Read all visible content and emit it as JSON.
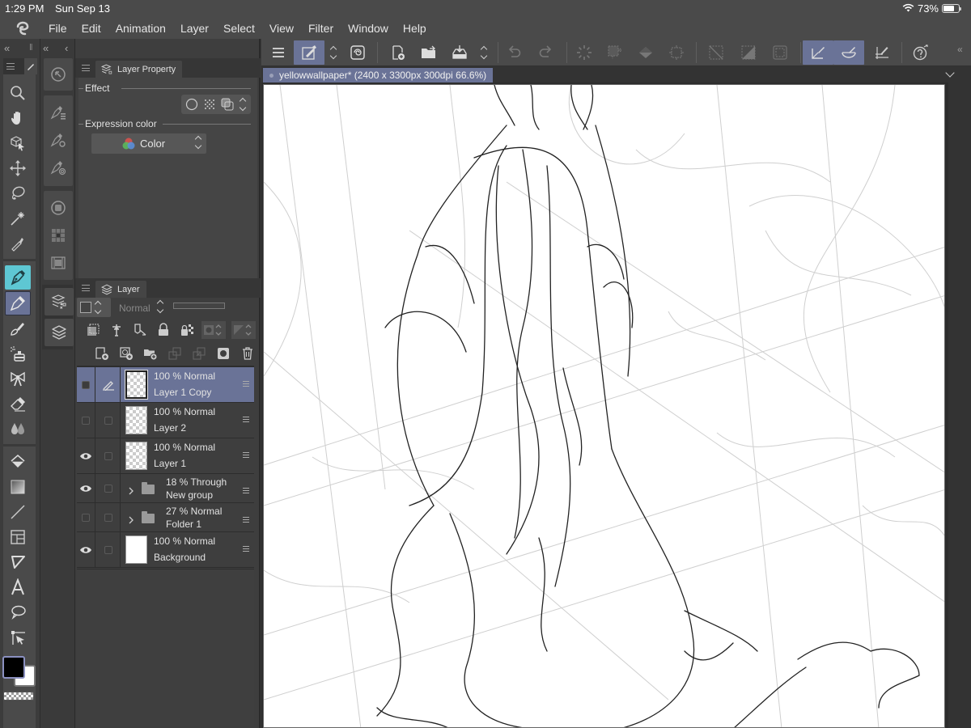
{
  "status_bar": {
    "time": "1:29 PM",
    "date": "Sun Sep 13",
    "battery": "73%",
    "battery_level": 0.73
  },
  "menubar": {
    "items": [
      "File",
      "Edit",
      "Animation",
      "Layer",
      "Select",
      "View",
      "Filter",
      "Window",
      "Help"
    ]
  },
  "toolbar": {
    "buttons": [
      {
        "name": "menu-icon"
      },
      {
        "name": "quick-access-icon",
        "active": true
      },
      {
        "name": "stepper-icon"
      },
      {
        "name": "clip-studio-icon"
      },
      {
        "name": "new-canvas-icon"
      },
      {
        "name": "open-folder-icon"
      },
      {
        "name": "save-icon"
      },
      {
        "name": "stepper-icon"
      },
      {
        "name": "undo-icon"
      },
      {
        "name": "redo-icon"
      },
      {
        "name": "spinner-icon"
      },
      {
        "name": "selection-expand-icon"
      },
      {
        "name": "fill-icon"
      },
      {
        "name": "transform-icon"
      },
      {
        "name": "deselect-icon"
      },
      {
        "name": "invert-selection-icon"
      },
      {
        "name": "selection-border-icon"
      },
      {
        "name": "ruler-snap-icon",
        "active": true
      },
      {
        "name": "special-ruler-snap-icon",
        "active": true
      },
      {
        "name": "grid-snap-icon"
      },
      {
        "name": "help-icon"
      }
    ]
  },
  "document_tab": {
    "title": "yellowwallpaper* (2400 x 3300px 300dpi 66.6%)"
  },
  "layer_property_panel": {
    "tab_label": "Layer Property",
    "effect_label": "Effect",
    "expression_color_label": "Expression color",
    "expression_color_value": "Color"
  },
  "layer_panel": {
    "tab_label": "Layer",
    "blend_mode": "Normal",
    "layers": [
      {
        "opacity_mode": "100 % Normal",
        "name": "Layer 1 Copy",
        "visible": false,
        "selected": true,
        "editing": true,
        "type": "raster"
      },
      {
        "opacity_mode": "100 % Normal",
        "name": "Layer 2",
        "visible": false,
        "selected": false,
        "type": "raster"
      },
      {
        "opacity_mode": "100 % Normal",
        "name": "Layer 1",
        "visible": true,
        "selected": false,
        "type": "raster"
      },
      {
        "opacity_mode": "18 % Through",
        "name": "New group",
        "visible": true,
        "selected": false,
        "type": "folder"
      },
      {
        "opacity_mode": "27 % Normal",
        "name": "Folder 1",
        "visible": false,
        "selected": false,
        "type": "folder"
      },
      {
        "opacity_mode": "100 % Normal",
        "name": "Background",
        "visible": true,
        "selected": false,
        "type": "paper"
      }
    ]
  },
  "tools": {
    "items": [
      {
        "name": "zoom-tool"
      },
      {
        "name": "hand-tool"
      },
      {
        "name": "object-tool"
      },
      {
        "name": "move-tool"
      },
      {
        "name": "lasso-tool"
      },
      {
        "name": "magic-wand-tool"
      },
      {
        "name": "eyedropper-tool"
      },
      {
        "name": "pen-tool",
        "active": "teal"
      },
      {
        "name": "pencil-tool",
        "active": "blue"
      },
      {
        "name": "brush-tool"
      },
      {
        "name": "airbrush-tool"
      },
      {
        "name": "decoration-tool"
      },
      {
        "name": "eraser-tool"
      },
      {
        "name": "blend-tool"
      },
      {
        "name": "fill-tool"
      },
      {
        "name": "gradient-tool"
      },
      {
        "name": "line-tool"
      },
      {
        "name": "frame-tool"
      },
      {
        "name": "ruler-tool"
      },
      {
        "name": "text-tool"
      },
      {
        "name": "balloon-tool"
      },
      {
        "name": "correct-line-tool"
      }
    ],
    "main_color": "#000000",
    "sub_color": "#ffffff"
  },
  "colors": {
    "accent": "#6a7397",
    "pen_active": "#5ec7d3",
    "panel_bg": "#3e3e3e",
    "toolbar_bg": "#4a4a4a"
  }
}
